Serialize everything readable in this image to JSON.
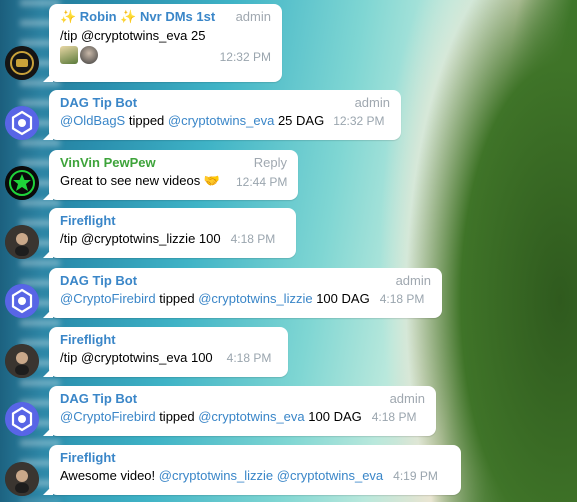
{
  "messages": [
    {
      "name": "✨ Robin ✨ Nvr DMs 1st",
      "role": "admin",
      "text": "/tip @cryptotwins_eva 25",
      "time": "12:32 PM",
      "stickers": [
        "bottle",
        "avatar"
      ]
    },
    {
      "name": "DAG Tip Bot",
      "role": "admin",
      "sender": "@OldBagS",
      "action": "tipped",
      "recipient": "@cryptotwins_eva",
      "amount": "25 DAG",
      "time": "12:32 PM"
    },
    {
      "name": "VinVin PewPew",
      "role": "Reply",
      "text": "Great to see new videos 🤝",
      "time": "12:44 PM"
    },
    {
      "name": "Fireflight",
      "text": "/tip @cryptotwins_lizzie 100",
      "time": "4:18 PM"
    },
    {
      "name": "DAG Tip Bot",
      "role": "admin",
      "sender": "@CryptoFirebird",
      "action": "tipped",
      "recipient": "@cryptotwins_lizzie",
      "amount": "100 DAG",
      "time": "4:18 PM"
    },
    {
      "name": "Fireflight",
      "text": "/tip @cryptotwins_eva 100",
      "time": "4:18 PM"
    },
    {
      "name": "DAG Tip Bot",
      "role": "admin",
      "sender": "@CryptoFirebird",
      "action": "tipped",
      "recipient": "@cryptotwins_eva",
      "amount": "100 DAG",
      "time": "4:18 PM"
    },
    {
      "name": "Fireflight",
      "prefix": "Awesome video!",
      "mention1": "@cryptotwins_lizzie",
      "mention2": "@cryptotwins_eva",
      "time": "4:19 PM"
    }
  ],
  "colors": {
    "blue_name": "#3a86c8",
    "green_name": "#3da33a",
    "bubble": "#ffffff",
    "meta": "#a0a8b0"
  }
}
